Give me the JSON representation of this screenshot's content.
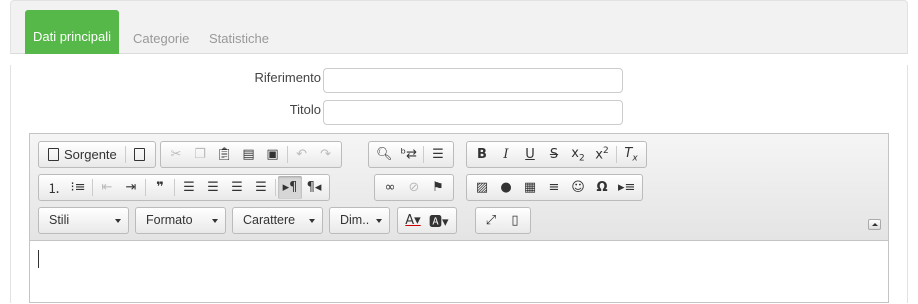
{
  "tabs": [
    {
      "label": "Dati principali",
      "active": true
    },
    {
      "label": "Categorie",
      "active": false
    },
    {
      "label": "Statistiche",
      "active": false
    }
  ],
  "form": {
    "riferimento_label": "Riferimento",
    "riferimento_value": "",
    "titolo_label": "Titolo",
    "titolo_value": ""
  },
  "toolbar": {
    "source_label": "Sorgente",
    "combos": {
      "styles": "Stili",
      "format": "Formato",
      "font": "Carattere",
      "size": "Dim.."
    }
  },
  "editor": {
    "content": ""
  },
  "colors": {
    "tab_active": "#55b848",
    "tab_inactive_text": "#999999"
  }
}
